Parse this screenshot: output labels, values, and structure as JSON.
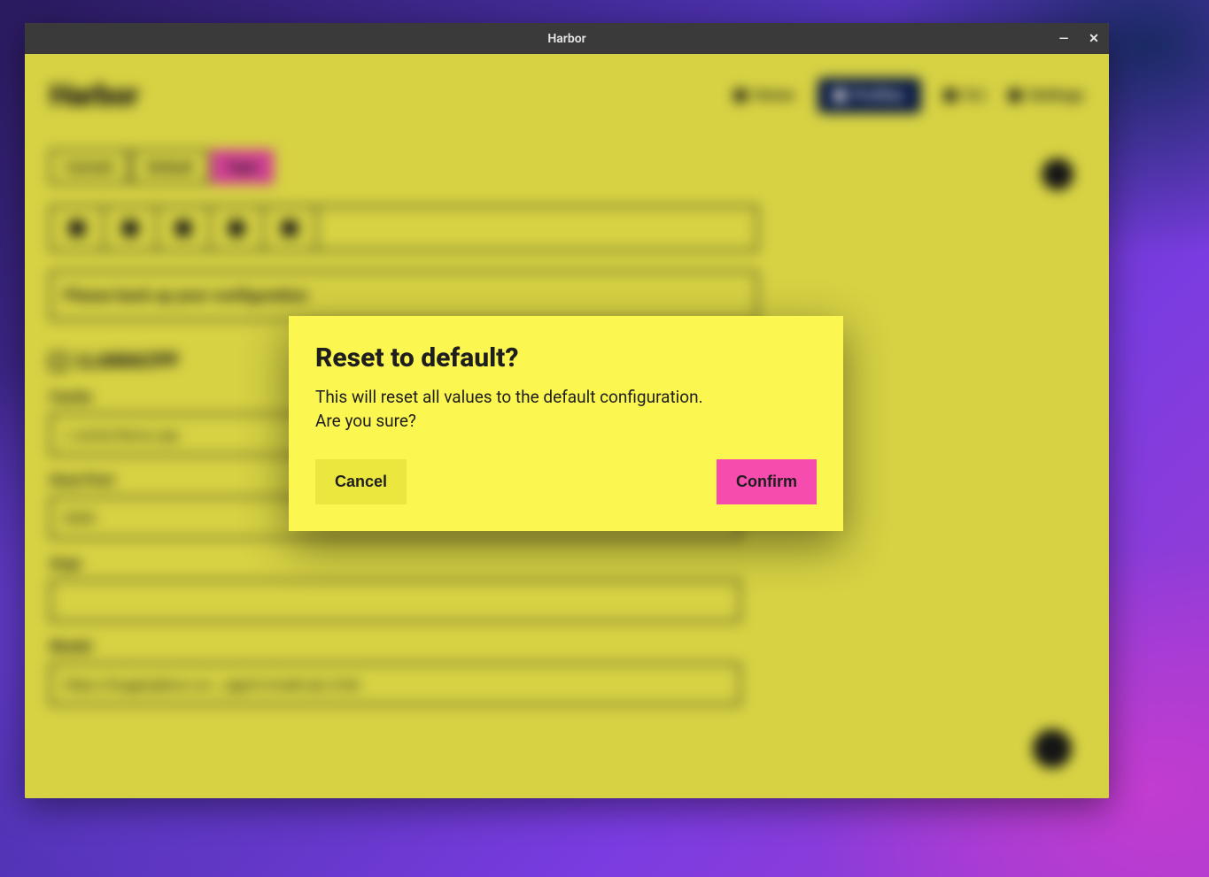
{
  "window": {
    "title": "Harbor"
  },
  "header": {
    "logo": "Harbor",
    "nav": {
      "home": "Home",
      "profiles": "Profiles",
      "cli": "CLI",
      "settings": "Settings"
    }
  },
  "tabs": {
    "current": "Current",
    "default": "Default",
    "type": "Type"
  },
  "banner": "Please back up your configuration",
  "section": {
    "title": "LLAMACPP",
    "fields": {
      "cache_label": "Cache",
      "cache_value": "/.cache/llama.cpp",
      "hostport_label": "Host Port",
      "hostport_value": "8080",
      "args_label": "Args",
      "args_value": "",
      "model_label": "Model",
      "model_value": "https://huggingface.co/…/ggml-model-q4_0.bin"
    }
  },
  "modal": {
    "title": "Reset to default?",
    "body_line1": "This will reset all values to the default configuration.",
    "body_line2": "Are you sure?",
    "cancel": "Cancel",
    "confirm": "Confirm"
  }
}
